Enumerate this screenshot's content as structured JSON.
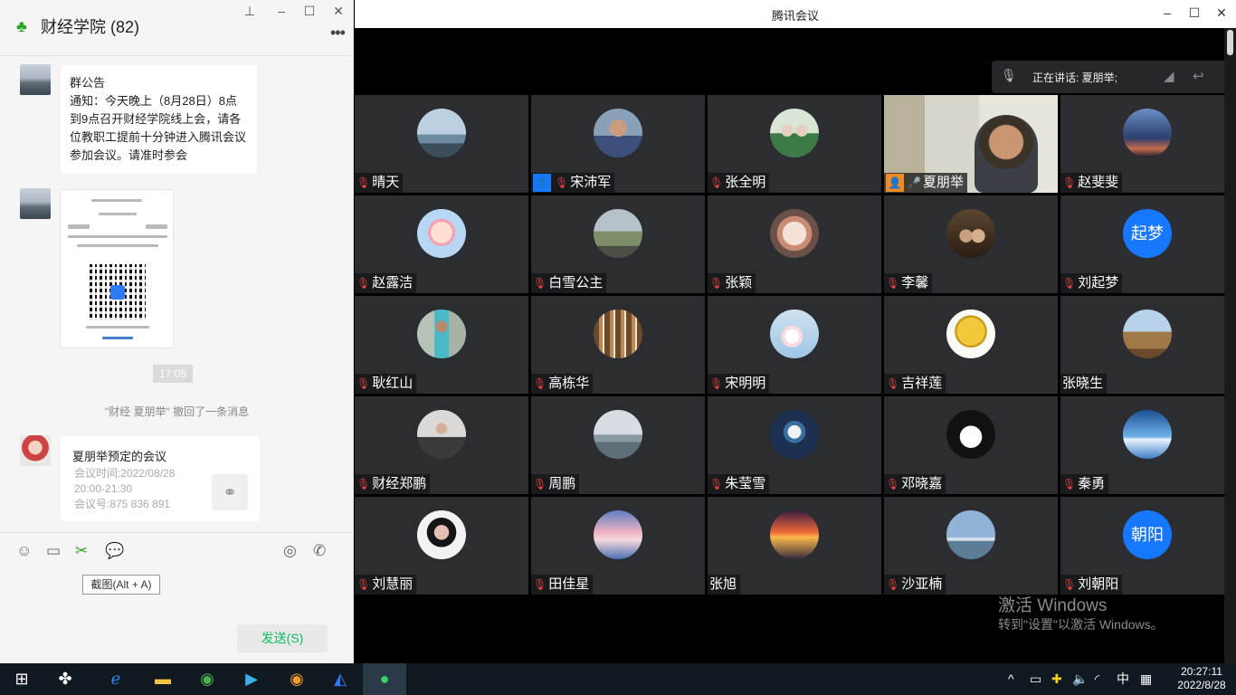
{
  "chat": {
    "title": "财经学院 (82)",
    "notice": {
      "title": "群公告",
      "body": "通知：今天晚上（8月28日）8点到9点召开财经学院线上会，请各位教职工提前十分钟进入腾讯会议参加会议。请准时参会"
    },
    "time_chip": "17:05",
    "system_message": "\"财经  夏朋举\" 撤回了一条消息",
    "meeting_card": {
      "title": "夏朋举预定的会议",
      "time_label": "会议时间:2022/08/28",
      "time_range": "20:00-21:30",
      "meeting_id": "会议号:875 836 891"
    },
    "tooltip": "截图(Alt + A)",
    "send_button": "发送(S)"
  },
  "meeting": {
    "window_title": "腾讯会议",
    "speaking": "正在讲话: 夏朋举;",
    "participants": [
      {
        "name": "晴天",
        "pic": "sea"
      },
      {
        "name": "宋沛军",
        "pic": "man",
        "badge": true
      },
      {
        "name": "张全明",
        "pic": "kids"
      },
      {
        "name": "夏朋举",
        "pic": "video",
        "badge": true,
        "speaking": true
      },
      {
        "name": "赵斐斐",
        "pic": "moon"
      },
      {
        "name": "赵露洁",
        "pic": "cartoon"
      },
      {
        "name": "白雪公主",
        "pic": "tree"
      },
      {
        "name": "张颖",
        "pic": "cat"
      },
      {
        "name": "李馨",
        "pic": "family"
      },
      {
        "name": "刘起梦",
        "text_avatar": "起梦"
      },
      {
        "name": "耿红山",
        "pic": "boy"
      },
      {
        "name": "高栋华",
        "pic": "library"
      },
      {
        "name": "宋明明",
        "pic": "flowers"
      },
      {
        "name": "吉祥莲",
        "pic": "gold"
      },
      {
        "name": "张晓生",
        "pic": "camel",
        "no_mic": true
      },
      {
        "name": "财经郑鹏",
        "pic": "girl"
      },
      {
        "name": "周鹏",
        "pic": "mist"
      },
      {
        "name": "朱莹雪",
        "pic": "anime"
      },
      {
        "name": "邓晓嘉",
        "pic": "panda"
      },
      {
        "name": "秦勇",
        "pic": "blue"
      },
      {
        "name": "刘慧丽",
        "pic": "woman"
      },
      {
        "name": "田佳星",
        "pic": "cloud"
      },
      {
        "name": "张旭",
        "pic": "sunset",
        "no_mic": true
      },
      {
        "name": "沙亚楠",
        "pic": "lake"
      },
      {
        "name": "刘朝阳",
        "text_avatar": "朝阳"
      }
    ]
  },
  "watermark": {
    "line1": "激活 Windows",
    "line2": "转到\"设置\"以激活 Windows。"
  },
  "taskbar": {
    "time": "20:27:11",
    "date": "2022/8/28",
    "ime": "中"
  }
}
